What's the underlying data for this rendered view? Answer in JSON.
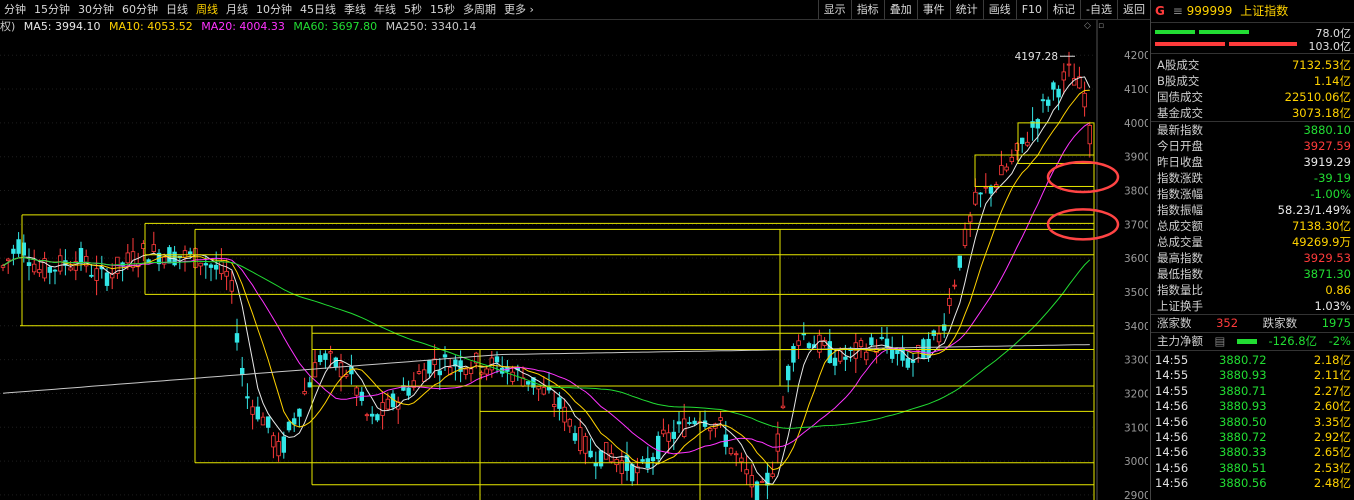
{
  "toolbar": {
    "periods": [
      "分钟",
      "15分钟",
      "30分钟",
      "60分钟",
      "日线",
      "周线",
      "月线",
      "10分钟",
      "45日线",
      "季线",
      "年线",
      "5秒",
      "15秒",
      "多周期",
      "更多 ›"
    ],
    "active_period": "周线",
    "tools": [
      "显示",
      "指标",
      "叠加",
      "事件",
      "统计",
      "画线",
      "F10",
      "标记",
      "-自选",
      "返回"
    ]
  },
  "ma_bar": {
    "prefix": "权)",
    "ma5": "MA5: 3994.10",
    "ma10": "MA10: 4053.52",
    "ma20": "MA20: 4004.33",
    "ma60": "MA60: 3697.80",
    "ma250": "MA250: 3340.14"
  },
  "colors": {
    "up": "#ff3b3b",
    "down": "#22dd33",
    "ma5": "#e8e8e8",
    "ma10": "#ffd200",
    "ma20": "#ff33ff",
    "ma60": "#22dd33",
    "ma250": "#c8c8c8",
    "box": "#e8e800",
    "circle": "#ff4444"
  },
  "chart_data": {
    "type": "candlestick",
    "price_axis_ticks": [
      4200,
      4100,
      4000,
      3900,
      3800,
      3700,
      3600,
      3500,
      3400,
      3300,
      3200,
      3100,
      3000,
      2900
    ],
    "ylim": [
      2885,
      4245
    ],
    "high_label": "4197.28",
    "support_lines": [
      3728,
      3703,
      3685,
      3610,
      3493,
      3400,
      3378,
      3330,
      3222,
      3147,
      2995,
      2930,
      2865
    ],
    "markers": [
      "◇",
      "▫"
    ]
  },
  "panel": {
    "icon": "G",
    "code": "999999",
    "name": "上证指数",
    "bar_top": "78.0亿",
    "bar_bottom": "103.0亿",
    "volume_rows": [
      {
        "label": "A股成交",
        "value": "7132.53亿"
      },
      {
        "label": "B股成交",
        "value": "1.14亿"
      },
      {
        "label": "国债成交",
        "value": "22510.06亿"
      },
      {
        "label": "基金成交",
        "value": "3073.18亿"
      }
    ],
    "quote_rows": [
      {
        "label": "最新指数",
        "value": "3880.10",
        "color": "dn"
      },
      {
        "label": "今日开盘",
        "value": "3927.59",
        "color": "up"
      },
      {
        "label": "昨日收盘",
        "value": "3919.29",
        "color": "wh"
      },
      {
        "label": "指数涨跌",
        "value": "-39.19",
        "color": "dn"
      },
      {
        "label": "指数涨幅",
        "value": "-1.00%",
        "color": "dn"
      },
      {
        "label": "指数振幅",
        "value": "58.23/1.49%",
        "color": "wh"
      },
      {
        "label": "总成交额",
        "value": "7138.30亿",
        "color": "yl"
      },
      {
        "label": "总成交量",
        "value": "49269.9万",
        "color": "yl"
      },
      {
        "label": "最高指数",
        "value": "3929.53",
        "color": "up"
      },
      {
        "label": "最低指数",
        "value": "3871.30",
        "color": "dn"
      },
      {
        "label": "指数量比",
        "value": "0.86",
        "color": "yl"
      },
      {
        "label": "上证换手",
        "value": "1.03%",
        "color": "wh"
      }
    ],
    "breadth": {
      "up_label": "涨家数",
      "up_value": "352",
      "down_label": "跌家数",
      "down_value": "1975"
    },
    "main_flow": {
      "label": "主力净额",
      "value": "-126.8亿",
      "pct": "-2%"
    },
    "ticks": [
      {
        "time": "14:55",
        "price": "3880.72",
        "vol": "2.18亿"
      },
      {
        "time": "14:55",
        "price": "3880.93",
        "vol": "2.11亿"
      },
      {
        "time": "14:55",
        "price": "3880.71",
        "vol": "2.27亿"
      },
      {
        "time": "14:56",
        "price": "3880.93",
        "vol": "2.60亿"
      },
      {
        "time": "14:56",
        "price": "3880.50",
        "vol": "3.35亿"
      },
      {
        "time": "14:56",
        "price": "3880.72",
        "vol": "2.92亿"
      },
      {
        "time": "14:56",
        "price": "3880.33",
        "vol": "2.65亿"
      },
      {
        "time": "14:56",
        "price": "3880.51",
        "vol": "2.53亿"
      },
      {
        "time": "14:56",
        "price": "3880.56",
        "vol": "2.48亿"
      }
    ]
  }
}
